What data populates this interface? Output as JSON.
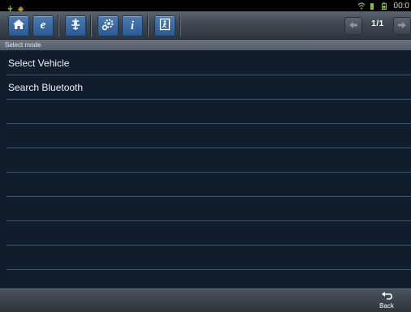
{
  "status_bar": {
    "time": "00:0",
    "left_icons": [
      "usb-icon",
      "diagnostic-app-icon"
    ],
    "right_icons": [
      "wifi-icon",
      "battery-icon",
      "signal-icon"
    ]
  },
  "toolbar": {
    "buttons": [
      "home-icon",
      "browser-icon",
      "vehicle-diagnosis-icon",
      "settings-icon",
      "info-icon",
      "exit-icon"
    ],
    "pager": "1/1"
  },
  "section_header": "Select mode",
  "list": {
    "items": [
      "Select Vehicle",
      "Search Bluetooth",
      "",
      "",
      "",
      "",
      "",
      "",
      "",
      ""
    ]
  },
  "bottom_bar": {
    "back_label": "Back"
  },
  "colors": {
    "background": "#111c2c",
    "row_divider": "#3f5363",
    "toolbar_button": "#2a5a92",
    "status_icons": "#7bc043"
  }
}
